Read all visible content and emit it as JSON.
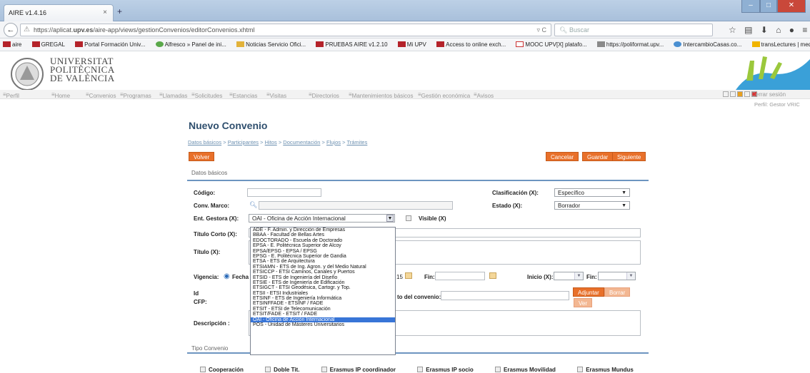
{
  "browser": {
    "tab_title": "AIRE v1.4.16",
    "tab_close": "×",
    "new_tab": "+",
    "url_prefix": "https://aplicat.",
    "url_domain": "upv.es",
    "url_rest": "/aire-app/views/gestionConvenios/editorConvenios.xhtml",
    "search_placeholder": "Buscar",
    "bookmarks": [
      "aire",
      "GREGAL",
      "Portal Formación Univ...",
      "Alfresco » Panel de ini...",
      "Noticias Servicio Ofici...",
      "PRUEBAS AIRE v1.2.10",
      "Mi UPV",
      "Access to online exch...",
      "MOOC UPV[X] platafo...",
      "https://poliformat.upv...",
      "IntercambioCasas.co...",
      "transLectures | media ..."
    ]
  },
  "header": {
    "university_line1": "UNIVERSITAT",
    "university_line2": "POLITÈCNICA",
    "university_line3": "DE VALÈNCIA"
  },
  "menu": {
    "items": [
      "Perfil",
      "Home",
      "Convenios",
      "Programas",
      "Llamadas",
      "Solicitudes",
      "Estancias",
      "Visitas",
      "Directorios",
      "Mantenimientos básicos",
      "Gestión económica",
      "Avisos"
    ],
    "logout": "Cerrar sesión",
    "perfil_label": "Perfil: Gestor VRIC"
  },
  "page": {
    "title": "Nuevo Convenio",
    "breadcrumb": [
      "Datos básicos",
      "Participantes",
      "Hitos",
      "Documentación",
      "Flujos",
      "Trámites"
    ],
    "breadcrumb_sep": ">",
    "btn_volver": "Volver",
    "btn_cancelar": "Cancelar",
    "btn_guardar": "Guardar",
    "btn_siguiente": "Siguiente",
    "section_datos": "Datos básicos",
    "section_tipo": "Tipo Convenio"
  },
  "form": {
    "codigo_label": "Código:",
    "conv_marco_label": "Conv. Marco:",
    "ent_gestora_label": "Ent. Gestora (X):",
    "ent_gestora_value": "OAI - Oficina de Acción Internacional",
    "visible_label": "Visible (X)",
    "clasificacion_label": "Clasificación (X):",
    "clasificacion_value": "Específico",
    "estado_label": "Estado (X):",
    "estado_value": "Borrador",
    "titulo_corto_label": "Título Corto (X):",
    "titulo_label": "Título (X):",
    "vigencia_label": "Vigencia:",
    "fecha_label": "Fecha",
    "fecha_fragment": "15",
    "fin_label": "Fin:",
    "inicio_label": "Inicio (X):",
    "fin2_label": "Fin:",
    "id_label": "Id",
    "cfp_label": "CFP:",
    "convenio_doc_label": "to del convenio:",
    "btn_adjuntar": "Adjuntar",
    "btn_borrar": "Borrar",
    "btn_ver": "Ver",
    "descripcion_label": "Descripción :"
  },
  "dropdown_options": [
    "ADE - F. Admin. y Dirección de Empresas",
    "BBAA - Facultad de Bellas Artes",
    "EDOCTORADO - Escuela de Doctorado",
    "EPSA - E. Politécnica Superior de Alcoy",
    "EPSA/EPSG - EPSA / EPSG",
    "EPSG - E. Politécnica Superior de Gandia",
    "ETSA - ETS de Arquitectura",
    "ETSIAMN - ETS de Ing. Agron. y del Medio Natural",
    "ETSICCP - ETSI Caminos, Canales y Puertos",
    "ETSID - ETS de Ingeniería del Diseño",
    "ETSIE - ETS de Ingeniería de Edificación",
    "ETSIGCT - ETSI Geodésica, Cartogr. y Top.",
    "ETSII - ETSI Industriales",
    "ETSINF - ETS de Ingeniería Informática",
    "ETSINFFADE - ETSINF / FADE",
    "ETSIT - ETSI de Telecomunicación",
    "ETSIT/FADE - ETSIT / FADE",
    "OAI - Oficina de Acción Internacional",
    "POS - Unidad de Másteres Universitarios"
  ],
  "dropdown_selected_index": 17,
  "tipo_convenio": [
    "Cooperación",
    "Doble Tit.",
    "Erasmus IP coordinador",
    "Erasmus IP socio",
    "Erasmus Movilidad",
    "Erasmus Mundus"
  ],
  "colors": {
    "accent_orange": "#e8702a",
    "title_blue": "#2f4f6e",
    "section_line": "#6d95c0",
    "selected_option": "#3875d7"
  }
}
